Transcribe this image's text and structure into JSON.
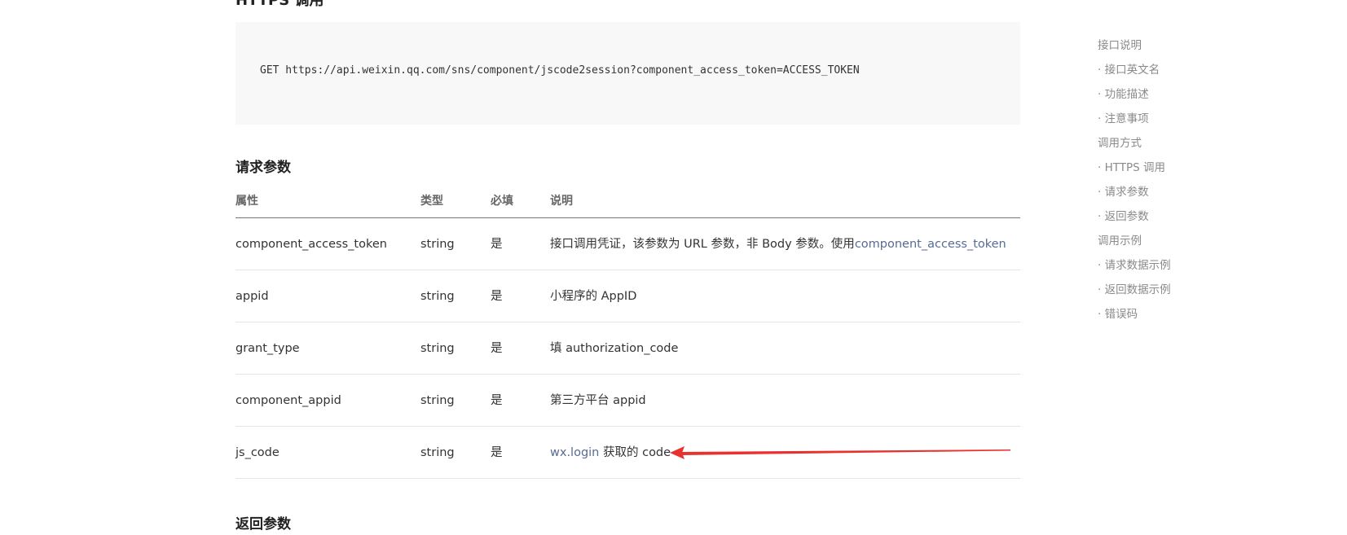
{
  "sections": {
    "https_call_title": "HTTPS 调用",
    "request_params_title": "请求参数",
    "return_params_title": "返回参数"
  },
  "code": {
    "request_line": "GET https://api.weixin.qq.com/sns/component/jscode2session?component_access_token=ACCESS_TOKEN"
  },
  "params_table": {
    "headers": [
      "属性",
      "类型",
      "必填",
      "说明"
    ],
    "rows": [
      {
        "name": "component_access_token",
        "type": "string",
        "required": "是",
        "desc_text": "接口调用凭证，该参数为 URL 参数，非 Body 参数。使用",
        "desc_link": "component_access_token",
        "desc_suffix": ""
      },
      {
        "name": "appid",
        "type": "string",
        "required": "是",
        "desc_text": "小程序的 AppID",
        "desc_link": "",
        "desc_suffix": ""
      },
      {
        "name": "grant_type",
        "type": "string",
        "required": "是",
        "desc_text": "填 authorization_code",
        "desc_link": "",
        "desc_suffix": ""
      },
      {
        "name": "component_appid",
        "type": "string",
        "required": "是",
        "desc_text": "第三方平台 appid",
        "desc_link": "",
        "desc_suffix": ""
      },
      {
        "name": "js_code",
        "type": "string",
        "required": "是",
        "desc_text": "",
        "desc_link": "wx.login",
        "desc_suffix": " 获取的 code"
      }
    ]
  },
  "annotation": {
    "arrow_color": "#e8322f"
  },
  "toc": {
    "items": [
      "接口说明",
      "· 接口英文名",
      "· 功能描述",
      "· 注意事项",
      "调用方式",
      "· HTTPS 调用",
      "· 请求参数",
      "· 返回参数",
      "调用示例",
      "· 请求数据示例",
      "· 返回数据示例",
      "· 错误码"
    ]
  }
}
